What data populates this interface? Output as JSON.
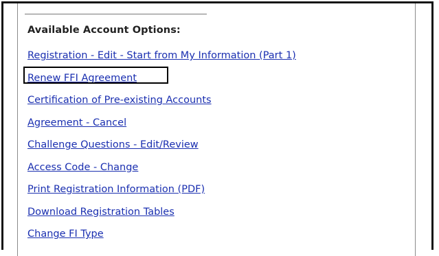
{
  "panel": {
    "heading": "Available Account Options:",
    "options": [
      {
        "label": "Registration - Edit - Start from My Information (Part 1)"
      },
      {
        "label": "Renew FFI Agreement",
        "highlighted": true
      },
      {
        "label": "Certification of Pre-existing Accounts"
      },
      {
        "label": "Agreement - Cancel"
      },
      {
        "label": "Challenge Questions - Edit/Review"
      },
      {
        "label": "Access Code - Change"
      },
      {
        "label": "Print Registration Information (PDF)"
      },
      {
        "label": "Download Registration Tables"
      },
      {
        "label": "Change FI Type"
      }
    ]
  },
  "colors": {
    "link": "#1a2fb0",
    "heading": "#222222",
    "highlight_border": "#000000"
  }
}
